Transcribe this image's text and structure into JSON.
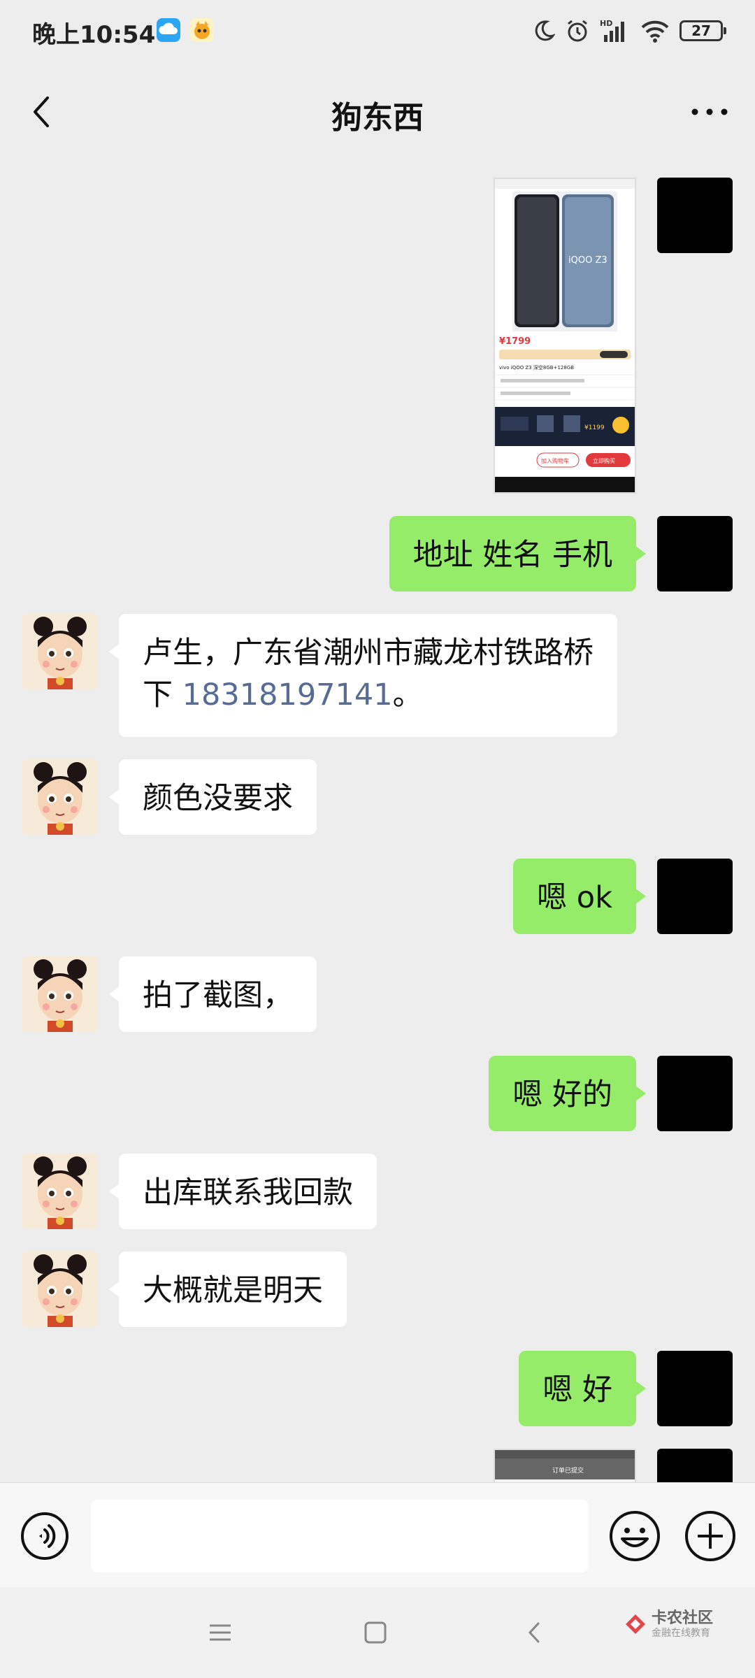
{
  "status_bar": {
    "time": "晚上10:54",
    "battery": "27"
  },
  "nav": {
    "title": "狗东西"
  },
  "chat": {
    "screenshot_1": {
      "price": "¥1799",
      "model": "vivo iQOO Z3 深空8GB+128GB",
      "brand_text": "iQOO Z3",
      "promo_price": "¥1199",
      "add_cart": "加入购物车",
      "buy_now": "立即购买"
    },
    "msg_address_request": "地址 姓名 手机",
    "msg_address_reply_line1": "卢生，广东省潮州市藏龙村铁路桥",
    "msg_address_reply_line2_prefix": "下 ",
    "msg_address_reply_phone": "18318197141",
    "msg_address_reply_suffix": "。",
    "msg_color": "颜色没要求",
    "msg_ok": "嗯 ok",
    "msg_screenshot": "拍了截图，",
    "msg_good": "嗯 好的",
    "msg_stock": "出库联系我回款",
    "msg_tomorrow": "大概就是明天",
    "msg_hao": "嗯 好",
    "screenshot_2_title": "订单已提交"
  },
  "input": {
    "placeholder": ""
  },
  "watermark": {
    "main": "卡农社区",
    "sub": "金融在线教育"
  },
  "colors": {
    "self_bubble": "#95ec69",
    "other_bubble": "#ffffff",
    "phone_link": "#576b95",
    "background": "#ededed"
  }
}
